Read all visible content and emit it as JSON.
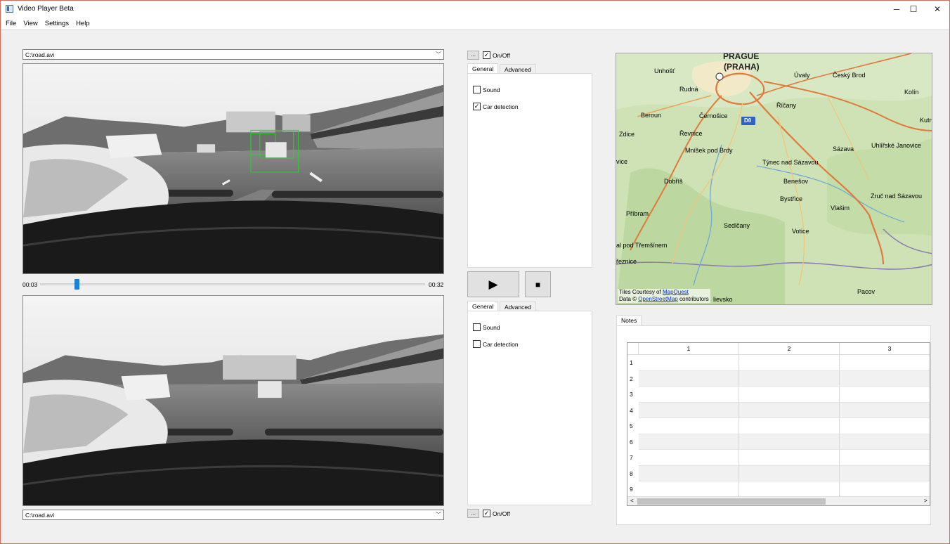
{
  "window": {
    "title": "Video Player Beta",
    "minimize": "─",
    "maximize": "☐",
    "close": "✕"
  },
  "menu": [
    "File",
    "View",
    "Settings",
    "Help"
  ],
  "top_video": {
    "source": "C:\\road.avi"
  },
  "bottom_video": {
    "source": "C:\\road.avi"
  },
  "timeline": {
    "current": "00:03",
    "total": "00:32",
    "progress": 0.094
  },
  "top_controls": {
    "browse_label": "...",
    "onoff_label": "On/Off",
    "onoff_checked": true,
    "tabs": [
      "General",
      "Advanced"
    ],
    "options": [
      {
        "label": "Sound",
        "checked": false
      },
      {
        "label": "Car detection",
        "checked": true
      }
    ]
  },
  "playback": {
    "play_icon": "▶",
    "stop_icon": "■"
  },
  "bottom_controls": {
    "browse_label": "...",
    "onoff_label": "On/Off",
    "onoff_checked": true,
    "tabs": [
      "General",
      "Advanced"
    ],
    "options": [
      {
        "label": "Sound",
        "checked": false
      },
      {
        "label": "Car detection",
        "checked": false
      }
    ]
  },
  "map": {
    "places": [
      "PRAGUE",
      "(PRAHA)",
      "Unhošť",
      "Úvaly",
      "Český Brod",
      "Rudná",
      "Kolín",
      "Beroun",
      "Černošice",
      "Říčany",
      "Zdice",
      "Řevnice",
      "Mníšek pod Brdy",
      "Sázava",
      "Uhlířské Janovice",
      "Týnec nad Sázavou",
      "Dobříš",
      "Benešov",
      "Bystřice",
      "Zruč nad Sázavou",
      "Příbram",
      "Vlašim",
      "Sedlčany",
      "Votice",
      "Pacov",
      "Kutná",
      "vice",
      "al pod Třemšínem",
      "řeznice",
      "lievsko"
    ],
    "highway": "D0",
    "credit_line1": "Tiles Courtesy of ",
    "credit_link1": "MapQuest",
    "credit_line2": "Data © ",
    "credit_link2": "OpenStreetMap",
    "credit_tail": " contributors"
  },
  "notes": {
    "tab": "Notes",
    "columns": [
      "1",
      "2",
      "3"
    ],
    "rows": [
      "1",
      "2",
      "3",
      "4",
      "5",
      "6",
      "7",
      "8",
      "9"
    ],
    "scroll_left": "<",
    "scroll_right": ">"
  }
}
